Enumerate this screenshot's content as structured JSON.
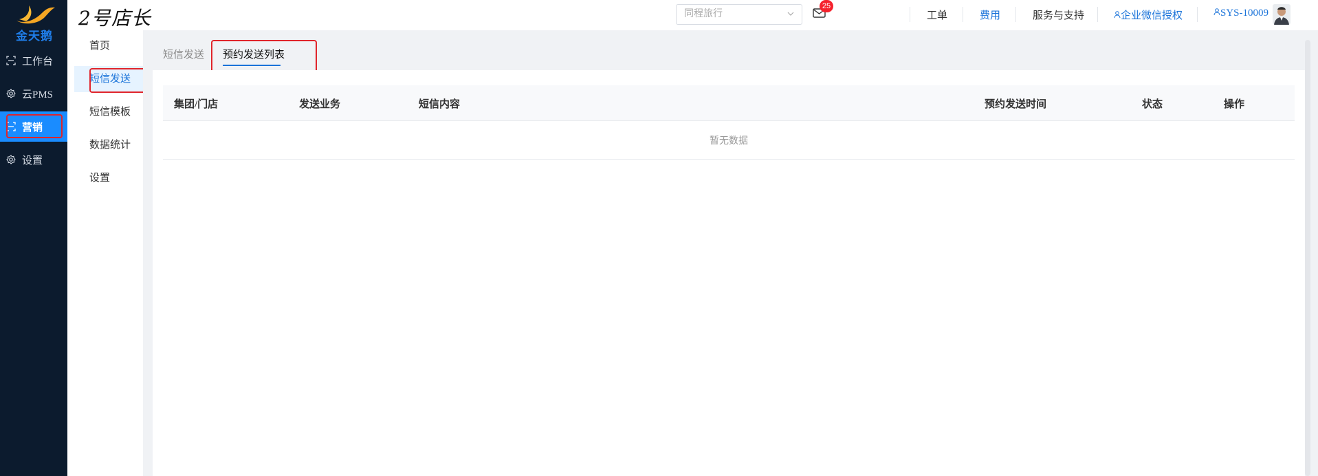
{
  "brand": {
    "logo_text": "金天鹅",
    "accent": "#1a8cff",
    "sidebar_bg": "#0c1b2e"
  },
  "sidebar": {
    "items": [
      {
        "label": "工作台",
        "icon": "workbench-icon"
      },
      {
        "label": "云PMS",
        "icon": "gear-icon"
      },
      {
        "label": "营销",
        "icon": "marketing-icon",
        "active": true
      },
      {
        "label": "设置",
        "icon": "gear-icon"
      }
    ]
  },
  "header": {
    "store_title": "2号店长",
    "channel_select": {
      "placeholder": "同程旅行"
    },
    "mail_badge": "25",
    "nav": {
      "ticket": "工单",
      "fees": "费用",
      "service": "服务与支持",
      "wecom_auth": "企业微信授权",
      "account": "SYS-10009"
    }
  },
  "submenu": {
    "items": [
      {
        "label": "首页"
      },
      {
        "label": "短信发送",
        "active": true
      },
      {
        "label": "短信模板"
      },
      {
        "label": "数据统计"
      },
      {
        "label": "设置"
      }
    ]
  },
  "tabs": [
    {
      "label": "短信发送"
    },
    {
      "label": "预约发送列表",
      "active": true
    }
  ],
  "table": {
    "columns": [
      "集团/门店",
      "发送业务",
      "短信内容",
      "预约发送时间",
      "状态",
      "操作"
    ],
    "empty_text": "暂无数据"
  }
}
